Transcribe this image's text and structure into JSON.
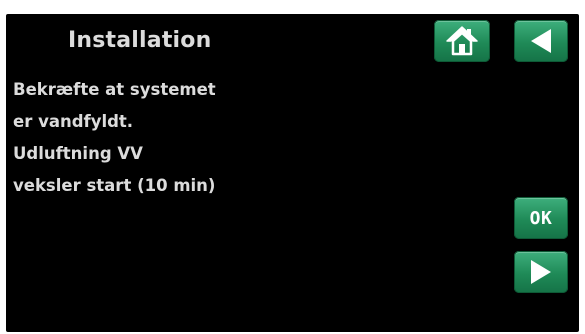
{
  "header": {
    "title": "Installation",
    "home_icon": "home-icon",
    "back_icon": "back-arrow-icon"
  },
  "message": {
    "lines": [
      "Bekræfte at systemet",
      "er vandfyldt.",
      "Udluftning VV",
      "veksler start (10 min)"
    ]
  },
  "actions": {
    "ok_label": "OK",
    "next_icon": "forward-arrow-icon"
  },
  "colors": {
    "screen_background": "#000000",
    "text": "#dcdcdc",
    "button_green": "#1f8a57",
    "button_icon": "#ffffff"
  }
}
